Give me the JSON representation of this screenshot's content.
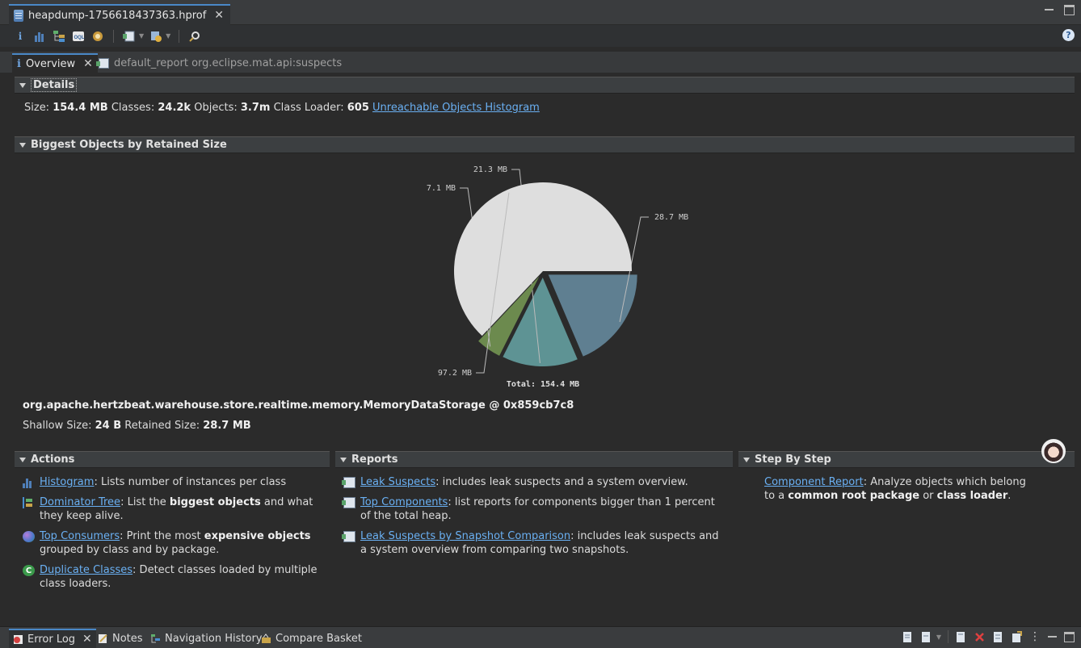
{
  "editor_tab": {
    "title": "heapdump-1756618437363.hprof"
  },
  "toolbar": {
    "icons": [
      "info-icon",
      "histogram-icon",
      "dominator-tree-icon",
      "oql-icon",
      "heap-dump-overview-icon",
      "query-browser-icon",
      "find-object-icon",
      "search-icon"
    ],
    "help": "?"
  },
  "inner_tabs": {
    "overview_label": "Overview",
    "report_label": "default_report org.eclipse.mat.api:suspects"
  },
  "details": {
    "header": "Details",
    "size_label": "Size:",
    "size_value": "154.4 MB",
    "classes_label": "Classes:",
    "classes_value": "24.2k",
    "objects_label": "Objects:",
    "objects_value": "3.7m",
    "loader_label": "Class Loader:",
    "loader_value": "605",
    "link": "Unreachable Objects Histogram"
  },
  "biggest": {
    "header": "Biggest Objects by Retained Size",
    "total_label": "Total: 154.4 MB",
    "object_name": "org.apache.hertzbeat.warehouse.store.realtime.memory.MemoryDataStorage @ 0x859cb7c8",
    "shallow_label": "Shallow Size:",
    "shallow_value": "24 B",
    "retained_label": "Retained Size:",
    "retained_value": "28.7 MB"
  },
  "chart_data": {
    "type": "pie",
    "slices": [
      {
        "label": "28.7 MB",
        "value": 28.7,
        "color": "#5f7f91"
      },
      {
        "label": "21.3 MB",
        "value": 21.3,
        "color": "#5e9394"
      },
      {
        "label": "7.1 MB",
        "value": 7.1,
        "color": "#6c8a4e"
      },
      {
        "label": "97.2 MB",
        "value": 97.2,
        "color": "#dedede"
      }
    ],
    "total": 154.4,
    "total_label": "Total: 154.4 MB"
  },
  "actions": {
    "header": "Actions",
    "histogram_link": "Histogram",
    "histogram_desc": ": Lists number of instances per class",
    "dominator_link": "Dominator Tree",
    "dominator_pre": ": List the ",
    "dominator_bold": "biggest objects",
    "dominator_post": " and what they keep alive.",
    "consumers_link": "Top Consumers",
    "consumers_pre": ": Print the most ",
    "consumers_bold": "expensive objects",
    "consumers_post": " grouped by class and by package.",
    "duplicate_link": "Duplicate Classes",
    "duplicate_desc": ": Detect classes loaded by multiple class loaders.",
    "duplicate_icon_letter": "C"
  },
  "reports": {
    "header": "Reports",
    "leak_link": "Leak Suspects",
    "leak_desc": ": includes leak suspects and a system overview.",
    "components_link": "Top Components",
    "components_desc": ": list reports for components bigger than 1 percent of the total heap.",
    "comparison_link": "Leak Suspects by Snapshot Comparison",
    "comparison_desc": ": includes leak suspects and a system overview from comparing two snapshots."
  },
  "step": {
    "header": "Step By Step",
    "component_link": "Component Report",
    "component_pre": ": Analyze objects which belong to a ",
    "component_bold1": "common root package",
    "component_mid": " or ",
    "component_bold2": "class loader",
    "component_post": "."
  },
  "bottom_tabs": {
    "error_log": "Error Log",
    "notes": "Notes",
    "nav_history": "Navigation History",
    "compare_basket": "Compare Basket"
  }
}
